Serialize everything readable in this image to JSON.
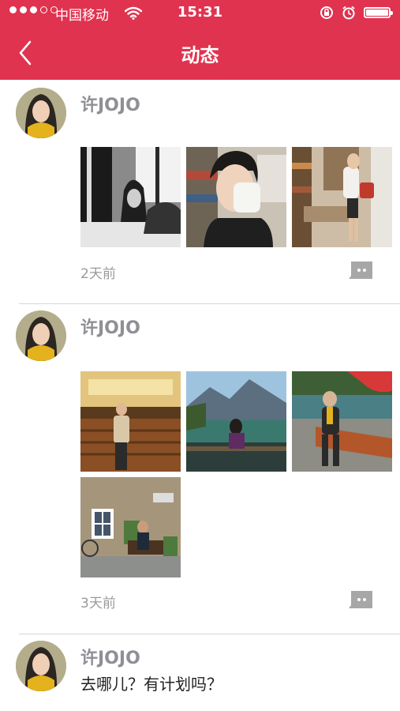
{
  "status_bar": {
    "carrier": "中国移动",
    "time": "15:31"
  },
  "nav": {
    "title": "动态"
  },
  "posts": [
    {
      "author": "许JOJO",
      "time": "2天前"
    },
    {
      "author": "许JOJO",
      "time": "3天前"
    },
    {
      "author": "许JOJO",
      "text": "去哪儿？有计划吗？"
    }
  ],
  "colors": {
    "header": "#e0334f",
    "name": "#8f8f95",
    "time": "#9a9a9a"
  },
  "icons": [
    "back-icon",
    "wifi-icon",
    "lock-rotation-icon",
    "alarm-icon",
    "battery-icon",
    "comment-icon"
  ]
}
